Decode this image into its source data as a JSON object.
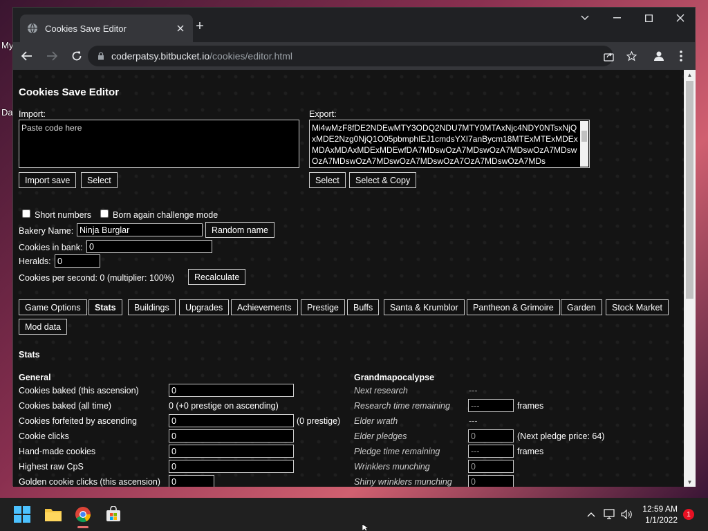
{
  "desktop": {
    "icon_label_1": "My",
    "icon_label_2": "Da"
  },
  "browser": {
    "tab_title": "Cookies Save Editor",
    "url_host": "coderpatsy.bitbucket.io",
    "url_path": "/cookies/editor.html"
  },
  "page": {
    "title": "Cookies Save Editor",
    "import_label": "Import:",
    "import_placeholder": "Paste code here",
    "import_button": "Import save",
    "import_select": "Select",
    "export_label": "Export:",
    "export_value": "Mi4wMzF8fDE2NDEwMTY3ODQ2NDU7MTY0MTAxNjc4NDY0NTsxNjQxMDE2Nzg0NjQ1O05pbmphIEJ1cmdsYXI7anBycm18MTExMTExMDExMDAxMDAxMDExMDEwfDA7MDswOzA7MDswOzA7MDswOzA7MDswOzA7MDswOzA7MDswOzA7MDswOzA7OzA7MDswOzA7MDs",
    "export_select": "Select",
    "export_copy": "Select & Copy",
    "short_numbers": "Short numbers",
    "born_again": "Born again challenge mode",
    "bakery_name_label": "Bakery Name:",
    "bakery_name_value": "Ninja Burglar",
    "random_name": "Random name",
    "cookies_in_bank_label": "Cookies in bank:",
    "cookies_in_bank_value": "0",
    "heralds_label": "Heralds:",
    "heralds_value": "0",
    "cps_text": "Cookies per second: 0 (multiplier: 100%)",
    "recalculate": "Recalculate",
    "tabs": [
      "Game Options",
      "Stats",
      "Buildings",
      "Upgrades",
      "Achievements",
      "Prestige",
      "Buffs",
      "Santa & Krumblor",
      "Pantheon & Grimoire",
      "Garden",
      "Stock Market",
      "Mod data"
    ],
    "active_tab": "Stats",
    "section_title": "Stats",
    "general": {
      "heading": "General",
      "rows": [
        {
          "label": "Cookies baked (this ascension)",
          "value": "0"
        },
        {
          "label": "Cookies baked (all time)",
          "text": "0 (+0 prestige on ascending)"
        },
        {
          "label": "Cookies forfeited by ascending",
          "value": "0",
          "suffix": "(0 prestige)"
        },
        {
          "label": "Cookie clicks",
          "value": "0"
        },
        {
          "label": "Hand-made cookies",
          "value": "0"
        },
        {
          "label": "Highest raw CpS",
          "value": "0"
        },
        {
          "label": "Golden cookie clicks (this ascension)",
          "value": "0"
        }
      ]
    },
    "grandmapocalypse": {
      "heading": "Grandmapocalypse",
      "rows": [
        {
          "label": "Next research",
          "text": "---"
        },
        {
          "label": "Research time remaining",
          "value": "---",
          "suffix": "frames"
        },
        {
          "label": "Elder wrath",
          "text": "---"
        },
        {
          "label": "Elder pledges",
          "value": "0",
          "suffix": "(Next pledge price: 64)"
        },
        {
          "label": "Pledge time remaining",
          "value": "---",
          "suffix": "frames"
        },
        {
          "label": "Wrinklers munching",
          "value": "0"
        },
        {
          "label": "Shiny wrinklers munching",
          "value": "0"
        }
      ]
    }
  },
  "taskbar": {
    "time": "12:59 AM",
    "date": "1/1/2022",
    "notification_count": "1"
  }
}
